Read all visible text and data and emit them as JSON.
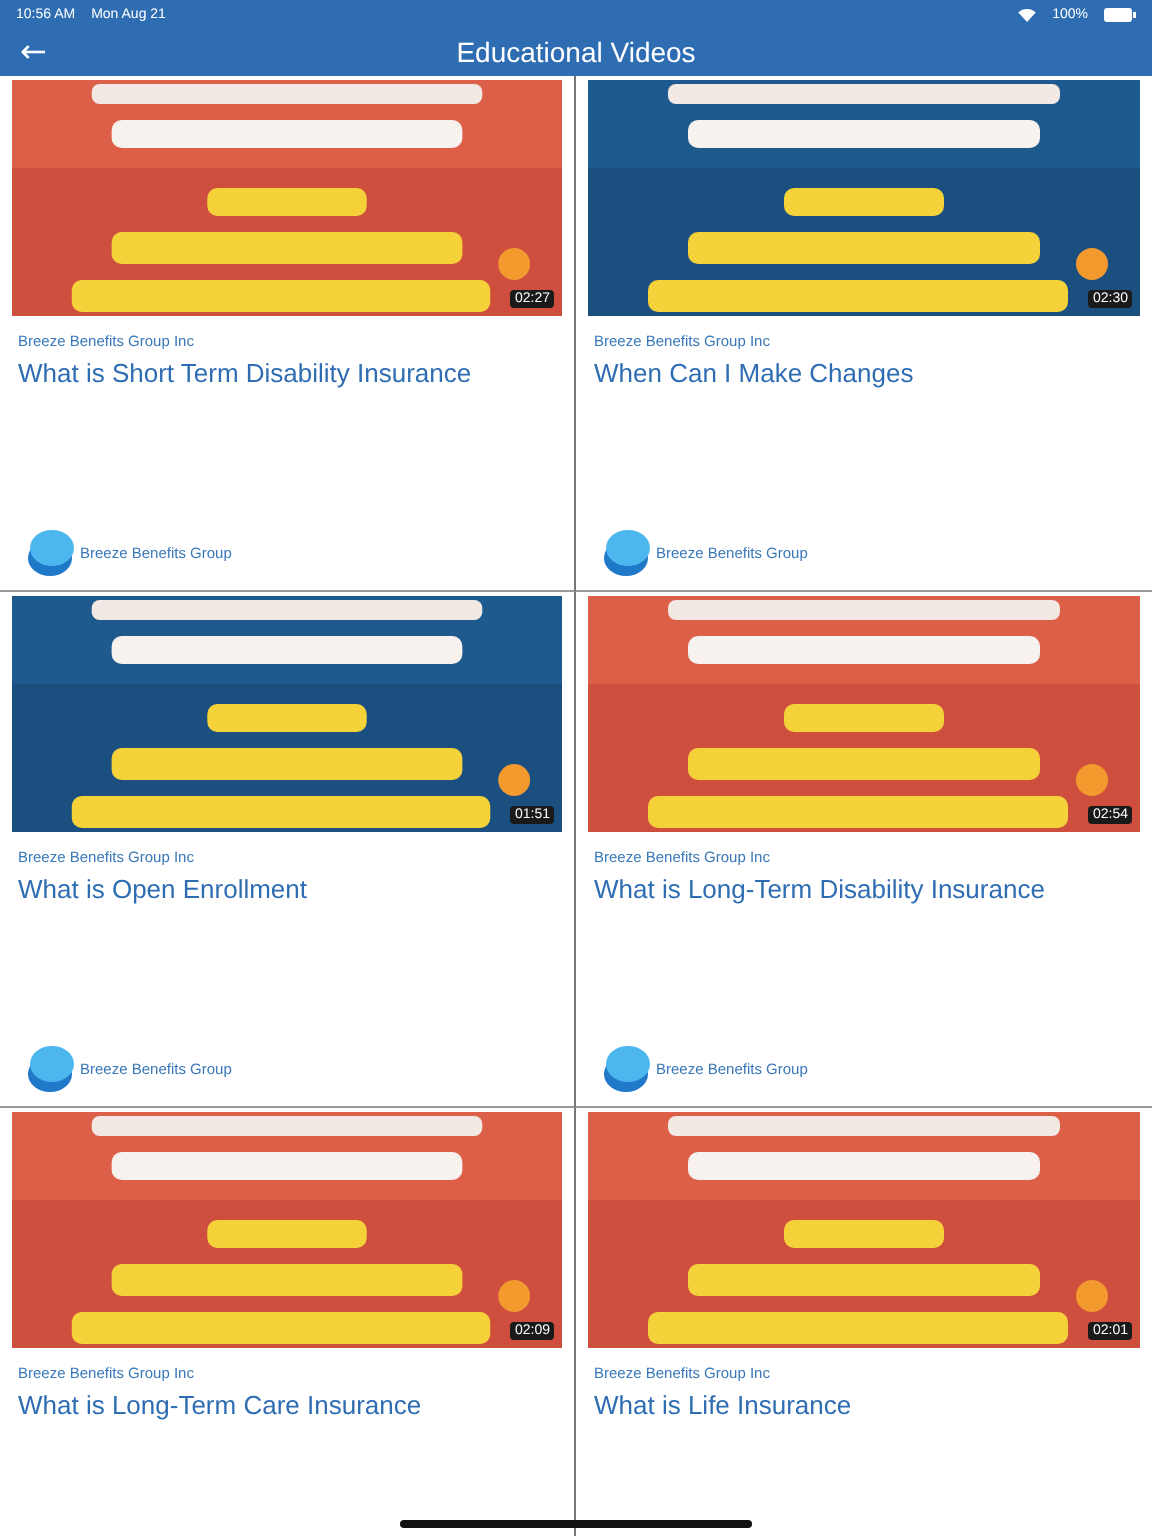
{
  "status_bar": {
    "time": "10:56 AM",
    "date": "Mon Aug 21",
    "battery": "100%"
  },
  "nav_bar": {
    "back": "←",
    "title": "Educational Videos"
  },
  "videos": [
    {
      "duration": "02:27",
      "publisher": "Breeze Benefits Group Inc",
      "title": "What is Short Term Disability Insurance",
      "channel": "Breeze Benefits Group"
    },
    {
      "duration": "02:30",
      "publisher": "Breeze Benefits Group Inc",
      "title": "When Can I Make Changes",
      "channel": "Breeze Benefits Group"
    },
    {
      "duration": "01:51",
      "publisher": "Breeze Benefits Group Inc",
      "title": "What is Open Enrollment",
      "channel": "Breeze Benefits Group"
    },
    {
      "duration": "02:54",
      "publisher": "Breeze Benefits Group Inc",
      "title": "What is Long-Term Disability Insurance",
      "channel": "Breeze Benefits Group"
    },
    {
      "duration": "02:09",
      "publisher": "Breeze Benefits Group Inc",
      "title": "What is Long-Term Care Insurance"
    },
    {
      "duration": "02:01",
      "publisher": "Breeze Benefits Group Inc",
      "title": "What is Life Insurance"
    }
  ]
}
